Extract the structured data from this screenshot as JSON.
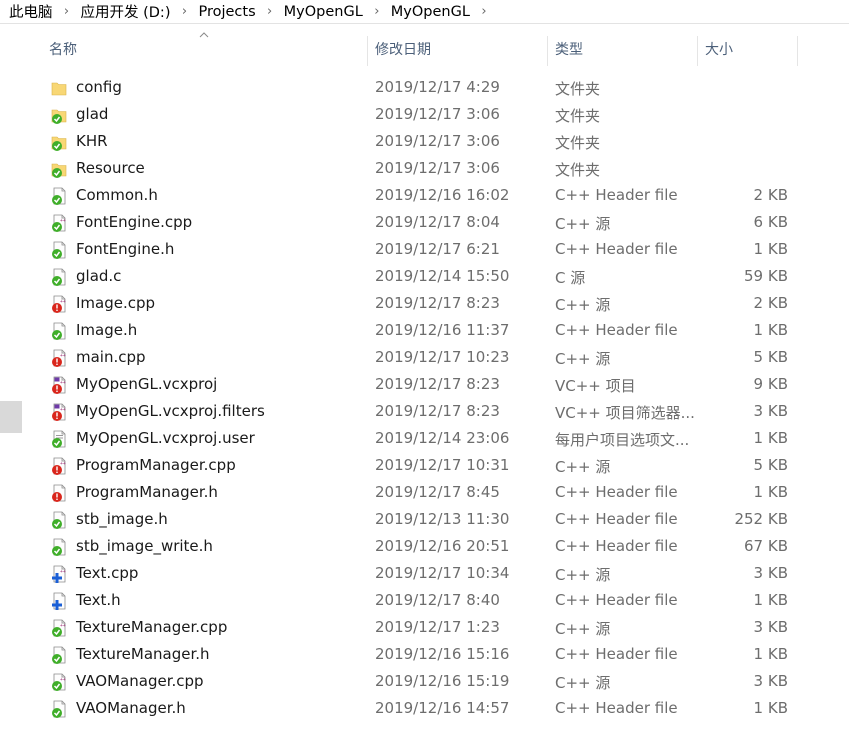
{
  "breadcrumb": [
    "此电脑",
    "应用开发 (D:)",
    "Projects",
    "MyOpenGL",
    "MyOpenGL"
  ],
  "columns": {
    "name": "名称",
    "date": "修改日期",
    "type": "类型",
    "size": "大小"
  },
  "colors": {
    "header_text": "#4c607a",
    "folder": "#f8d775",
    "overlay_green": "#3fae29",
    "overlay_red": "#d9261c",
    "overlay_blue": "#1a5fd6"
  },
  "files": [
    {
      "name": "config",
      "date": "2019/12/17 4:29",
      "type": "文件夹",
      "size": "",
      "icon": "folder-icon"
    },
    {
      "name": "glad",
      "date": "2019/12/17 3:06",
      "type": "文件夹",
      "size": "",
      "icon": "folder-synced-icon"
    },
    {
      "name": "KHR",
      "date": "2019/12/17 3:06",
      "type": "文件夹",
      "size": "",
      "icon": "folder-synced-icon"
    },
    {
      "name": "Resource",
      "date": "2019/12/17 3:06",
      "type": "文件夹",
      "size": "",
      "icon": "folder-synced-icon"
    },
    {
      "name": "Common.h",
      "date": "2019/12/16 16:02",
      "type": "C++ Header file",
      "size": "2 KB",
      "icon": "header-synced-icon"
    },
    {
      "name": "FontEngine.cpp",
      "date": "2019/12/17 8:04",
      "type": "C++ 源",
      "size": "6 KB",
      "icon": "cpp-synced-icon"
    },
    {
      "name": "FontEngine.h",
      "date": "2019/12/17 6:21",
      "type": "C++ Header file",
      "size": "1 KB",
      "icon": "header-synced-icon"
    },
    {
      "name": "glad.c",
      "date": "2019/12/14 15:50",
      "type": "C 源",
      "size": "59 KB",
      "icon": "c-synced-icon"
    },
    {
      "name": "Image.cpp",
      "date": "2019/12/17 8:23",
      "type": "C++ 源",
      "size": "2 KB",
      "icon": "cpp-modified-icon"
    },
    {
      "name": "Image.h",
      "date": "2019/12/16 11:37",
      "type": "C++ Header file",
      "size": "1 KB",
      "icon": "header-synced-icon"
    },
    {
      "name": "main.cpp",
      "date": "2019/12/17 10:23",
      "type": "C++ 源",
      "size": "5 KB",
      "icon": "cpp-modified-icon"
    },
    {
      "name": "MyOpenGL.vcxproj",
      "date": "2019/12/17 8:23",
      "type": "VC++ 项目",
      "size": "9 KB",
      "icon": "vcxproj-modified-icon"
    },
    {
      "name": "MyOpenGL.vcxproj.filters",
      "date": "2019/12/17 8:23",
      "type": "VC++ 项目筛选器...",
      "size": "3 KB",
      "icon": "vcxproj-modified-icon"
    },
    {
      "name": "MyOpenGL.vcxproj.user",
      "date": "2019/12/14 23:06",
      "type": "每用户项目选项文...",
      "size": "1 KB",
      "icon": "user-file-synced-icon"
    },
    {
      "name": "ProgramManager.cpp",
      "date": "2019/12/17 10:31",
      "type": "C++ 源",
      "size": "5 KB",
      "icon": "cpp-modified-icon"
    },
    {
      "name": "ProgramManager.h",
      "date": "2019/12/17 8:45",
      "type": "C++ Header file",
      "size": "1 KB",
      "icon": "header-modified-icon"
    },
    {
      "name": "stb_image.h",
      "date": "2019/12/13 11:30",
      "type": "C++ Header file",
      "size": "252 KB",
      "icon": "header-synced-icon"
    },
    {
      "name": "stb_image_write.h",
      "date": "2019/12/16 20:51",
      "type": "C++ Header file",
      "size": "67 KB",
      "icon": "header-synced-icon"
    },
    {
      "name": "Text.cpp",
      "date": "2019/12/17 10:34",
      "type": "C++ 源",
      "size": "3 KB",
      "icon": "cpp-added-icon"
    },
    {
      "name": "Text.h",
      "date": "2019/12/17 8:40",
      "type": "C++ Header file",
      "size": "1 KB",
      "icon": "header-added-icon"
    },
    {
      "name": "TextureManager.cpp",
      "date": "2019/12/17 1:23",
      "type": "C++ 源",
      "size": "3 KB",
      "icon": "cpp-synced-icon"
    },
    {
      "name": "TextureManager.h",
      "date": "2019/12/16 15:16",
      "type": "C++ Header file",
      "size": "1 KB",
      "icon": "header-synced-icon"
    },
    {
      "name": "VAOManager.cpp",
      "date": "2019/12/16 15:19",
      "type": "C++ 源",
      "size": "3 KB",
      "icon": "cpp-synced-icon"
    },
    {
      "name": "VAOManager.h",
      "date": "2019/12/16 14:57",
      "type": "C++ Header file",
      "size": "1 KB",
      "icon": "header-synced-icon"
    }
  ]
}
